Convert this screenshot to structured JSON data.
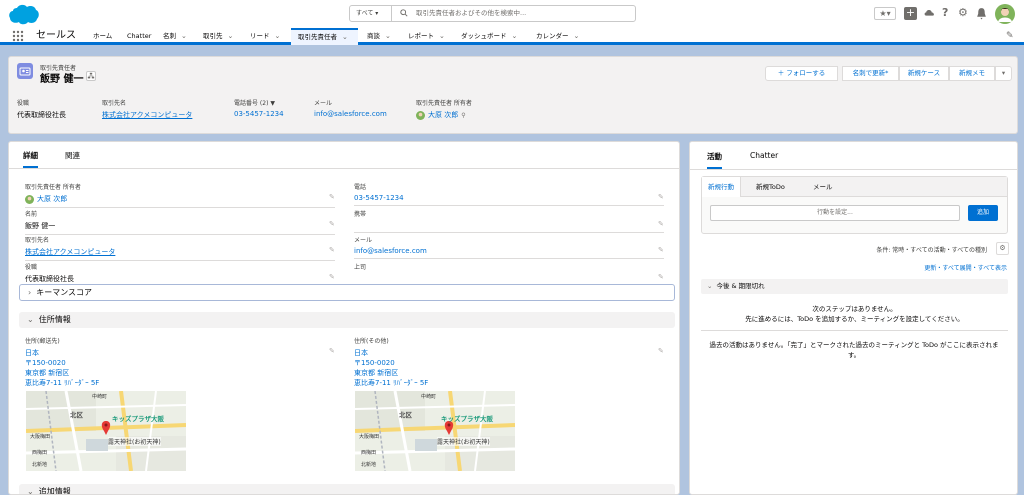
{
  "header": {
    "search_scope": "すべて ▾",
    "search_placeholder": "取引先責任者およびその他を検索中..."
  },
  "nav": {
    "app_name": "セールス",
    "tabs": [
      {
        "label": "ホーム",
        "chevron": false
      },
      {
        "label": "Chatter",
        "chevron": false
      },
      {
        "label": "名刺",
        "chevron": true
      },
      {
        "label": "取引先",
        "chevron": true
      },
      {
        "label": "リード",
        "chevron": true
      },
      {
        "label": "取引先責任者",
        "chevron": true
      },
      {
        "label": "商談",
        "chevron": true
      },
      {
        "label": "レポート",
        "chevron": true
      },
      {
        "label": "ダッシュボード",
        "chevron": true
      },
      {
        "label": "カレンダー",
        "chevron": true
      }
    ]
  },
  "record": {
    "object_type": "取引先責任者",
    "name": "飯野 健一",
    "buttons": [
      "＋ フォローする",
      "名刺で更新*",
      "新規ケース",
      "新規メモ"
    ],
    "highlights": [
      {
        "label": "役職",
        "value": "代表取締役社長"
      },
      {
        "label": "取引先名",
        "value": "株式会社アクメコンピュータ"
      },
      {
        "label": "電話番号 (2) ▼",
        "value": "03-5457-1234"
      },
      {
        "label": "メール",
        "value": "info@salesforce.com"
      },
      {
        "label": "取引先責任者 所有者",
        "value": "大原 次郎"
      }
    ]
  },
  "detail": {
    "tabs": [
      "詳細",
      "関連"
    ],
    "fields_left": [
      {
        "label": "取引先責任者 所有者",
        "value": "大原 次郎"
      },
      {
        "label": "名前",
        "value": "飯野 健一"
      },
      {
        "label": "取引先名",
        "value": "株式会社アクメコンピュータ"
      },
      {
        "label": "役職",
        "value": "代表取締役社長"
      }
    ],
    "fields_right": [
      {
        "label": "電話",
        "value": "03-5457-1234"
      },
      {
        "label": "携帯",
        "value": ""
      },
      {
        "label": "メール",
        "value": "info@salesforce.com"
      },
      {
        "label": "上司",
        "value": ""
      }
    ],
    "keyman_section": "キーマンスコア",
    "address_section": "住所情報",
    "mailing": {
      "label": "住所(郵送先)",
      "lines": [
        "日本",
        "〒150-0020",
        "東京都 新宿区",
        "恵比寿7-11 ﾘﾊﾞｰﾀﾞｰ 5F"
      ]
    },
    "other": {
      "label": "住所(その他)",
      "lines": [
        "日本",
        "〒150-0020",
        "東京都 新宿区",
        "恵比寿7-11 ﾘﾊﾞｰﾀﾞｰ 5F"
      ]
    },
    "map_labels": [
      "北区",
      "キッズプラザ大阪",
      "露天神社(お初天神)",
      "大阪梅田",
      "西梅田",
      "北新地",
      "中崎町"
    ],
    "additional_section": "追加情報"
  },
  "activity": {
    "tabs": [
      "活動",
      "Chatter"
    ],
    "publisher_tabs": [
      "新規行動",
      "新規ToDo",
      "メール"
    ],
    "input_placeholder": "行動を設定...",
    "add_button": "追加",
    "filter_text": "条件: 常時・すべての活動・すべての種別",
    "links": "更新・すべて展開・すべて表示",
    "upcoming_header": "今後 & 期限切れ",
    "no_steps_line1": "次のステップはありません。",
    "no_steps_line2": "先に進めるには、ToDo を追加するか、ミーティングを設定してください。",
    "past_text": "過去の活動はありません。「完了」とマークされた過去のミーティングと ToDo がここに表示されます。"
  },
  "colors": {
    "accent": "#0070d2",
    "brand": "#00a1e0",
    "contact_icon": "#7f8de1",
    "map_pin": "#e53935"
  }
}
